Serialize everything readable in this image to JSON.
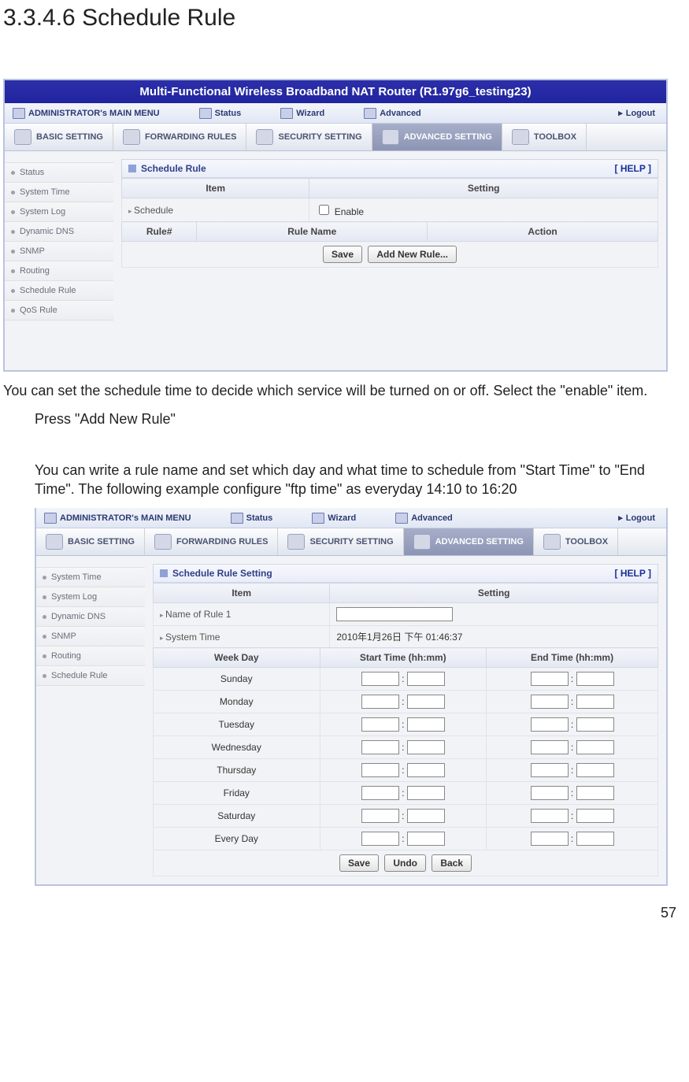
{
  "doc": {
    "heading": "3.3.4.6 Schedule Rule",
    "page_number": "57",
    "para1": "You can set the schedule time to decide which service will be turned on or off. Select the \"enable\" item.",
    "para2": "Press \"Add New Rule\"",
    "para3": "You can write a rule name and set which day and what time to schedule from \"Start Time\" to \"End Time\". The following example configure \"ftp time\" as everyday 14:10 to 16:20"
  },
  "router": {
    "title": "Multi-Functional Wireless Broadband NAT Router (R1.97g6_testing23)",
    "nav1": {
      "main_menu": "ADMINISTRATOR's MAIN MENU",
      "status": "Status",
      "wizard": "Wizard",
      "advanced": "Advanced",
      "logout": "Logout"
    },
    "tabs": {
      "basic": "BASIC SETTING",
      "forwarding": "FORWARDING RULES",
      "security": "SECURITY SETTING",
      "advanced": "ADVANCED SETTING",
      "toolbox": "TOOLBOX"
    },
    "panel1": {
      "sidebar": [
        "Status",
        "System Time",
        "System Log",
        "Dynamic DNS",
        "SNMP",
        "Routing",
        "Schedule Rule",
        "QoS Rule"
      ],
      "panel_title": "Schedule Rule",
      "help": "[ HELP ]",
      "headers": {
        "item": "Item",
        "setting": "Setting"
      },
      "rows": {
        "schedule_label": "Schedule",
        "enable_label": "Enable"
      },
      "headers2": {
        "rule_no": "Rule#",
        "rule_name": "Rule Name",
        "action": "Action"
      },
      "buttons": {
        "save": "Save",
        "add": "Add New Rule..."
      }
    },
    "panel2": {
      "sidebar": [
        "System Time",
        "System Log",
        "Dynamic DNS",
        "SNMP",
        "Routing",
        "Schedule Rule"
      ],
      "panel_title": "Schedule Rule Setting",
      "help": "[ HELP ]",
      "headers": {
        "item": "Item",
        "setting": "Setting"
      },
      "rows": {
        "name_label": "Name of Rule 1",
        "system_time_label": "System Time",
        "system_time_value": "2010年1月26日 下午 01:46:37"
      },
      "headers3": {
        "weekday": "Week Day",
        "start": "Start Time (hh:mm)",
        "end": "End Time (hh:mm)"
      },
      "days": [
        "Sunday",
        "Monday",
        "Tuesday",
        "Wednesday",
        "Thursday",
        "Friday",
        "Saturday",
        "Every Day"
      ],
      "buttons": {
        "save": "Save",
        "undo": "Undo",
        "back": "Back"
      }
    }
  }
}
